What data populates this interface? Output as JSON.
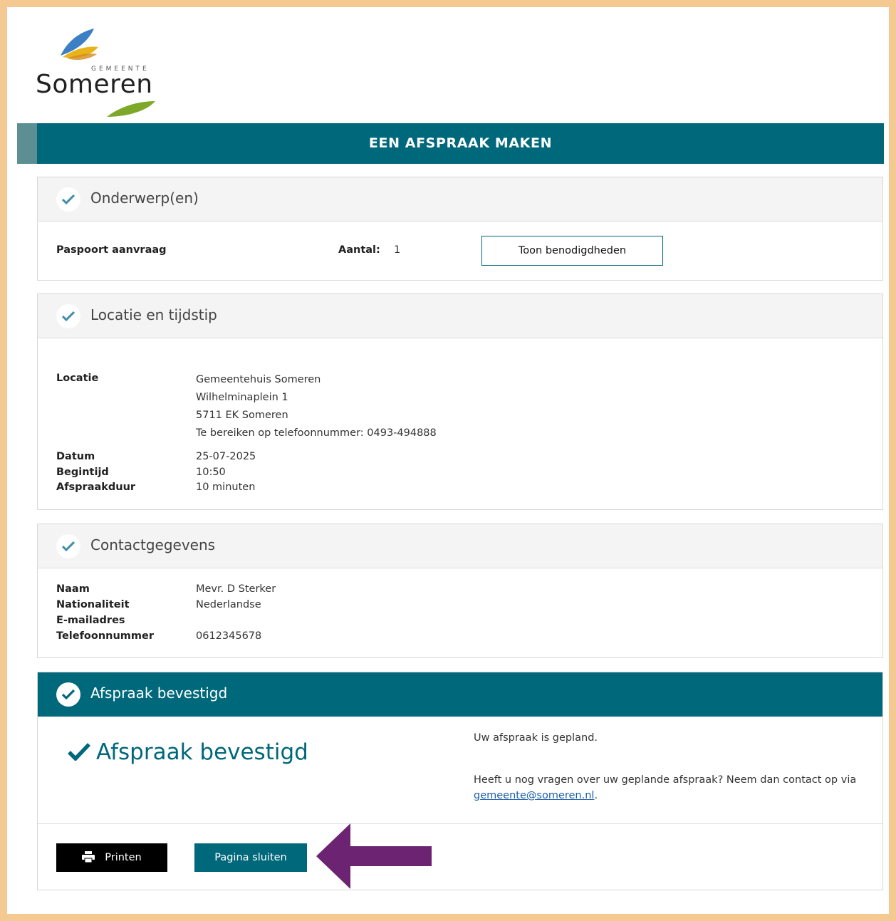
{
  "logo": {
    "small_text": "GEMEENTE",
    "big_text": "Someren"
  },
  "banner": {
    "title": "EEN AFSPRAAK MAKEN"
  },
  "subjects": {
    "title": "Onderwerp(en)",
    "item_label": "Paspoort aanvraag",
    "count_label": "Aantal:",
    "count_value": "1",
    "button_label": "Toon benodigdheden"
  },
  "location": {
    "title": "Locatie en tijdstip",
    "location_label": "Locatie",
    "address_lines": [
      "Gemeentehuis Someren",
      "Wilhelminaplein 1",
      "5711 EK Someren",
      "Te bereiken op telefoonnummer: 0493-494888"
    ],
    "date_label": "Datum",
    "date_value": "25-07-2025",
    "start_label": "Begintijd",
    "start_value": "10:50",
    "duration_label": "Afspraakduur",
    "duration_value": "10 minuten"
  },
  "contact": {
    "title": "Contactgegevens",
    "name_label": "Naam",
    "name_value": "Mevr. D Sterker",
    "nationality_label": "Nationaliteit",
    "nationality_value": "Nederlandse",
    "email_label": "E-mailadres",
    "email_value": "",
    "phone_label": "Telefoonnummer",
    "phone_value": "0612345678"
  },
  "confirmation": {
    "title": "Afspraak bevestigd",
    "big_text": "Afspraak bevestigd",
    "planned_text": "Uw afspraak is gepland.",
    "question_text": "Heeft u nog vragen over uw geplande afspraak? Neem dan contact op via",
    "email_link": "gemeente@someren.nl",
    "after_link": "."
  },
  "actions": {
    "print_label": "Printen",
    "close_label": "Pagina sluiten"
  },
  "colors": {
    "accent": "#00687b",
    "frame": "#f5c992",
    "annotation_arrow": "#6b2372"
  }
}
